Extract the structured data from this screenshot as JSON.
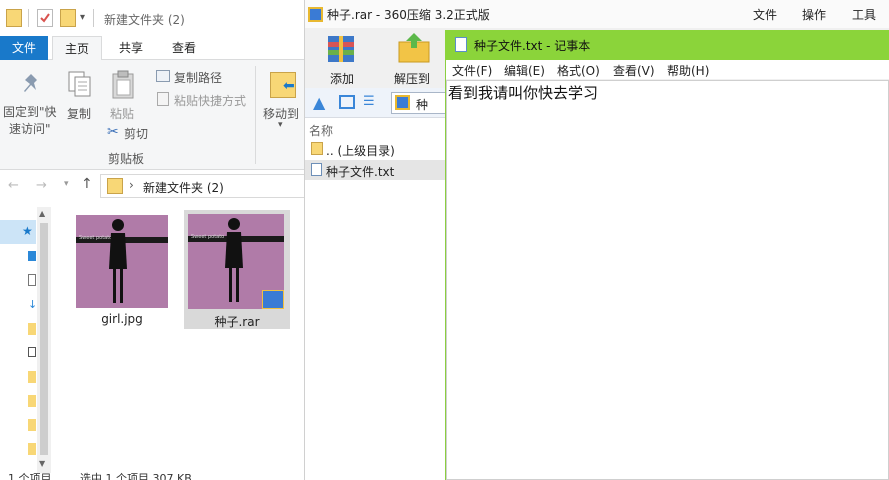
{
  "explorer": {
    "title": "新建文件夹 (2)",
    "tabs": [
      "文件",
      "主页",
      "共享",
      "查看"
    ],
    "ribbon": {
      "pin_label": "固定到\"快\n速访问\"",
      "copy_label": "复制",
      "paste_label": "粘贴",
      "copy_path_label": "复制路径",
      "paste_shortcut_label": "粘贴快捷方式",
      "cut_label": "剪切",
      "group_label": "剪贴板",
      "move_to_label": "移动到"
    },
    "breadcrumb": "新建文件夹 (2)",
    "files": [
      {
        "name": "girl.jpg",
        "thumb_text": "Sweet potato"
      },
      {
        "name": "种子.rar",
        "thumb_text": "Sweet potato"
      }
    ],
    "status": {
      "count": "1 个项目",
      "selected": "选中 1 个项目 307 KB"
    }
  },
  "zip": {
    "title": "种子.rar - 360压缩 3.2正式版",
    "menu": [
      "文件",
      "操作",
      "工具"
    ],
    "toolbar": {
      "add_label": "添加",
      "extract_label": "解压到"
    },
    "path": "种",
    "column_name": "名称",
    "items": [
      {
        "label": ".. (上级目录)"
      },
      {
        "label": "种子文件.txt"
      }
    ]
  },
  "notepad": {
    "title": "种子文件.txt - 记事本",
    "menu": [
      "文件(F)",
      "编辑(E)",
      "格式(O)",
      "查看(V)",
      "帮助(H)"
    ],
    "content": "看到我请叫你快去学习"
  },
  "colors": {
    "accent_blue": "#1979ca",
    "notepad_green": "#8bd43a",
    "thumb_purple": "#b07ba8"
  }
}
